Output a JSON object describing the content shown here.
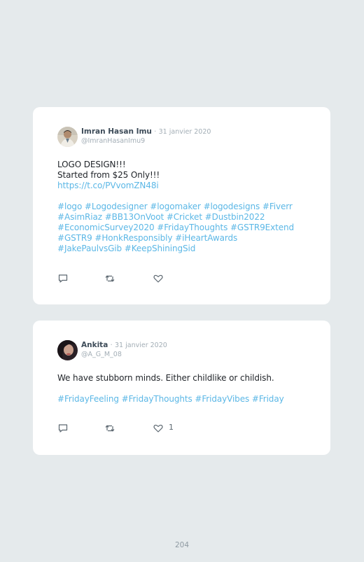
{
  "tweets": [
    {
      "author_name": "Imran Hasan Imu",
      "separator": "·",
      "date": "31 janvier 2020",
      "handle": "@ImranHasanImu9",
      "lines": [
        "LOGO DESIGN!!!",
        "Started from $25 Only!!!"
      ],
      "link": "https://t.co/PVvomZN48i",
      "hashtags": [
        "#logo",
        "#Logodesigner",
        "#logomaker",
        "#logodesigns",
        "#Fiverr",
        "#AsimRiaz",
        "#BB13OnVoot",
        "#Cricket",
        "#Dustbin2022",
        "#EconomicSurvey2020",
        "#FridayThoughts",
        "#GSTR9Extend",
        "#GSTR9",
        "#HonkResponsibly",
        "#iHeartAwards",
        "#JakePaulvsGib",
        "#KeepShiningSid"
      ],
      "like_count": ""
    },
    {
      "author_name": "Ankita",
      "separator": "·",
      "date": "31 janvier 2020",
      "handle": "@A_G_M_08",
      "lines": [
        "We have stubborn minds. Either childlike or childish."
      ],
      "link": "",
      "hashtags": [
        "#FridayFeeling",
        "#FridayThoughts",
        "#FridayVibes",
        "#Friday"
      ],
      "like_count": "1"
    }
  ],
  "page_number": "204",
  "colors": {
    "background": "#e5eaec",
    "card": "#ffffff",
    "link": "#5bb7e6",
    "muted": "#a3aeb6",
    "name": "#3e4c59"
  },
  "icons": {
    "reply": "reply-icon",
    "retweet": "retweet-icon",
    "like": "heart-icon"
  }
}
